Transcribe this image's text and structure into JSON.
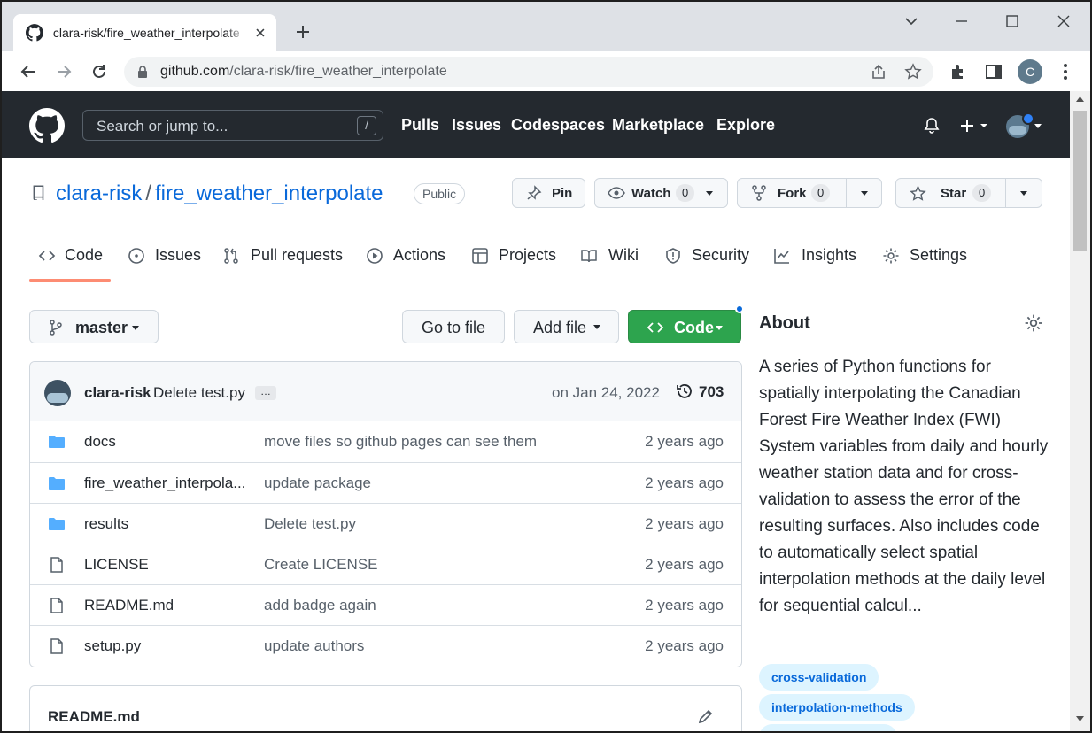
{
  "browser": {
    "tab_title": "clara-risk/fire_weather_interpolate",
    "url_host": "github.com",
    "url_path": "/clara-risk/fire_weather_interpolate",
    "profile_initial": "C"
  },
  "header": {
    "search_placeholder": "Search or jump to...",
    "search_shortcut": "/",
    "nav": [
      "Pulls",
      "Issues",
      "Codespaces",
      "Marketplace",
      "Explore"
    ]
  },
  "repo": {
    "owner": "clara-risk",
    "separator": "/",
    "name": "fire_weather_interpolate",
    "visibility": "Public",
    "pin_label": "Pin",
    "watch_label": "Watch",
    "watch_count": "0",
    "fork_label": "Fork",
    "fork_count": "0",
    "star_label": "Star",
    "star_count": "0"
  },
  "tabs": [
    {
      "label": "Code",
      "icon": "code-icon"
    },
    {
      "label": "Issues",
      "icon": "issue-icon"
    },
    {
      "label": "Pull requests",
      "icon": "pull-request-icon"
    },
    {
      "label": "Actions",
      "icon": "play-icon"
    },
    {
      "label": "Projects",
      "icon": "table-icon"
    },
    {
      "label": "Wiki",
      "icon": "book-icon"
    },
    {
      "label": "Security",
      "icon": "shield-icon"
    },
    {
      "label": "Insights",
      "icon": "graph-icon"
    },
    {
      "label": "Settings",
      "icon": "gear-icon"
    }
  ],
  "filebar": {
    "branch": "master",
    "go_to_file": "Go to file",
    "add_file": "Add file",
    "code": "Code"
  },
  "commit": {
    "user": "clara-risk",
    "message": "Delete test.py",
    "ellipsis": "…",
    "date": "on Jan 24, 2022",
    "count": "703"
  },
  "files": [
    {
      "type": "dir",
      "name": "docs",
      "message": "move files so github pages can see them",
      "time": "2 years ago"
    },
    {
      "type": "dir",
      "name": "fire_weather_interpola...",
      "message": "update package",
      "time": "2 years ago"
    },
    {
      "type": "dir",
      "name": "results",
      "message": "Delete test.py",
      "time": "2 years ago"
    },
    {
      "type": "file",
      "name": "LICENSE",
      "message": "Create LICENSE",
      "time": "2 years ago"
    },
    {
      "type": "file",
      "name": "README.md",
      "message": "add badge again",
      "time": "2 years ago"
    },
    {
      "type": "file",
      "name": "setup.py",
      "message": "update authors",
      "time": "2 years ago"
    }
  ],
  "readme": {
    "title": "README.md"
  },
  "about": {
    "heading": "About",
    "description": "A series of Python functions for spatially interpolating the Canadian Forest Fire Weather Index (FWI) System variables from daily and hourly weather station data and for cross-validation to assess the error of the resulting surfaces. Also includes code to automatically select spatial interpolation methods at the daily level for sequential calcul...",
    "topics": [
      "cross-validation",
      "interpolation-methods"
    ]
  },
  "colors": {
    "header_bg": "#24292f",
    "link": "#0969da",
    "code_button": "#2da44e",
    "tab_underline": "#fd8c73",
    "topic_bg": "#ddf4ff"
  }
}
